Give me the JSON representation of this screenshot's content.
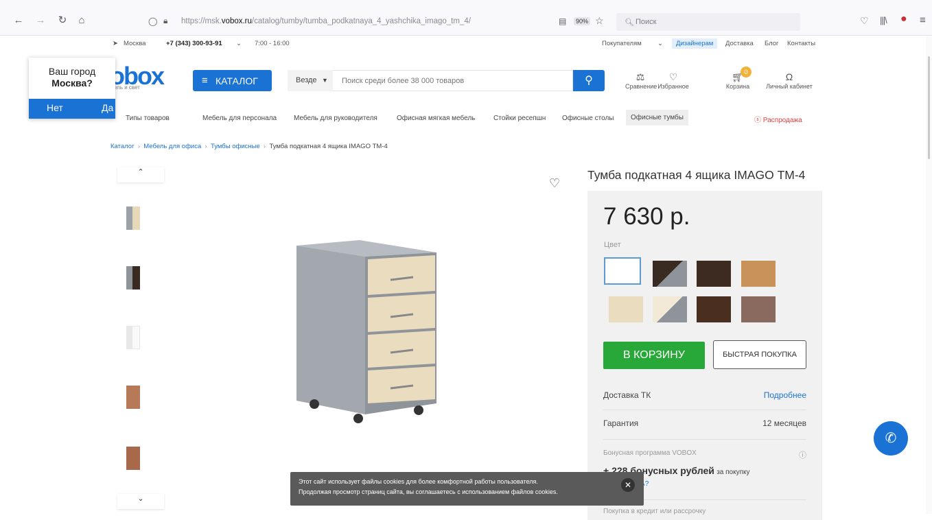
{
  "browser": {
    "url_prefix": "https://msk.",
    "url_domain": "vobox.ru",
    "url_path": "/catalog/tumby/tumba_podkatnaya_4_yashchika_imago_tm_4/",
    "zoom": "90%",
    "search_placeholder": "Поиск"
  },
  "topbar": {
    "city": "Москва",
    "phone": "+7 (343) 300-93-91",
    "hours": "7:00 - 16:00",
    "links": [
      "Покупателям",
      "Дизайнерам",
      "Доставка",
      "Блог",
      "Контакты"
    ]
  },
  "city_popup": {
    "line1": "Ваш город",
    "line2": "Москва?",
    "no": "Нет",
    "yes": "Да"
  },
  "header": {
    "logo": "obox",
    "logo_tagline": "ель и свет",
    "catalog_label": "КАТАЛОГ",
    "search_scope": "Везде",
    "search_placeholder": "Поиск среди более 38 000 товаров",
    "actions": [
      "Сравнение",
      "Избранное",
      "Корзина",
      "Личный кабинет"
    ],
    "cart_count": "0"
  },
  "categories": {
    "items": [
      "Типы товаров",
      "Мебель для персонала",
      "Мебель для руководителя",
      "Офисная мягкая мебель",
      "Стойки ресепшн",
      "Офисные столы",
      "Офисные тумбы"
    ],
    "sale": "Распродажа"
  },
  "breadcrumb": [
    "Каталог",
    "Мебель для офиса",
    "Тумбы офисные",
    "Тумба подкатная 4 ящика IMAGO ТМ-4"
  ],
  "product": {
    "title": "Тумба подкатная 4 ящика IMAGO ТМ-4",
    "price": "7 630 р.",
    "color_label": "Цвет",
    "add_to_cart": "В КОРЗИНУ",
    "quick_buy": "БЫСТРАЯ ПОКУПКА",
    "delivery_label": "Доставка ТК",
    "delivery_link": "Подробнее",
    "warranty_label": "Гарантия",
    "warranty_value": "12 месяцев",
    "bonus_label": "Бонусная программа VOBOX",
    "bonus_amount": "+ 228 бонусных рублей",
    "bonus_suffix": "за покупку",
    "bonus_link": "Как получить?",
    "credit_label": "Покупка в кредит или рассрочку"
  },
  "swatch_colors": [
    "#ffffff",
    "#3a2b22",
    "#3d2a20",
    "#c8935a",
    "#e9dcbf",
    "#f2ead6",
    "#4a2e20",
    "#8a6a5e"
  ],
  "cookie": {
    "line1": "Этот сайт использует файлы cookies для более комфортной работы пользователя.",
    "line2": "Продолжая просмотр страниц сайта, вы соглашаетесь с использованием файлов cookies."
  }
}
